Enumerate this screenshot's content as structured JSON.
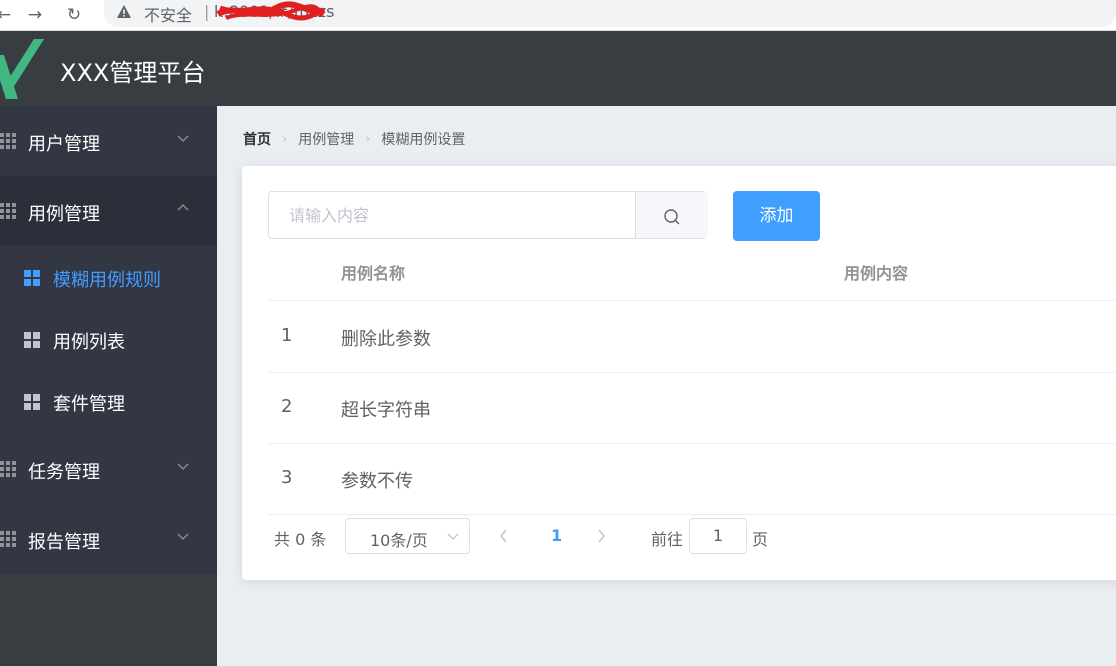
{
  "browser": {
    "security_label": "不安全",
    "separator": "|",
    "url": "k:8001/#/fuzzs"
  },
  "header": {
    "title": "XXX管理平台"
  },
  "sidebar": {
    "items": [
      {
        "label": "用户管理",
        "expanded": false
      },
      {
        "label": "用例管理",
        "expanded": true,
        "children": [
          {
            "label": "模糊用例规则",
            "active": true
          },
          {
            "label": "用例列表",
            "active": false
          },
          {
            "label": "套件管理",
            "active": false
          }
        ]
      },
      {
        "label": "任务管理",
        "expanded": false
      },
      {
        "label": "报告管理",
        "expanded": false
      }
    ]
  },
  "breadcrumb": [
    "首页",
    "用例管理",
    "模糊用例设置"
  ],
  "search": {
    "placeholder": "请输入内容"
  },
  "add_button": "添加",
  "table": {
    "columns": [
      "用例名称",
      "用例内容"
    ],
    "rows": [
      {
        "index": "1",
        "name": "删除此参数",
        "content": ""
      },
      {
        "index": "2",
        "name": "超长字符串",
        "content": ""
      },
      {
        "index": "3",
        "name": "参数不传",
        "content": ""
      }
    ]
  },
  "pagination": {
    "total": "共 0 条",
    "page_size": "10条/页",
    "current_page": "1",
    "goto_label": "前往",
    "goto_value": "1",
    "page_suffix": "页"
  },
  "colors": {
    "accent": "#409eff",
    "sidebar_bg": "#333744",
    "header_bg": "#373d41",
    "content_bg": "#e9eef3"
  }
}
